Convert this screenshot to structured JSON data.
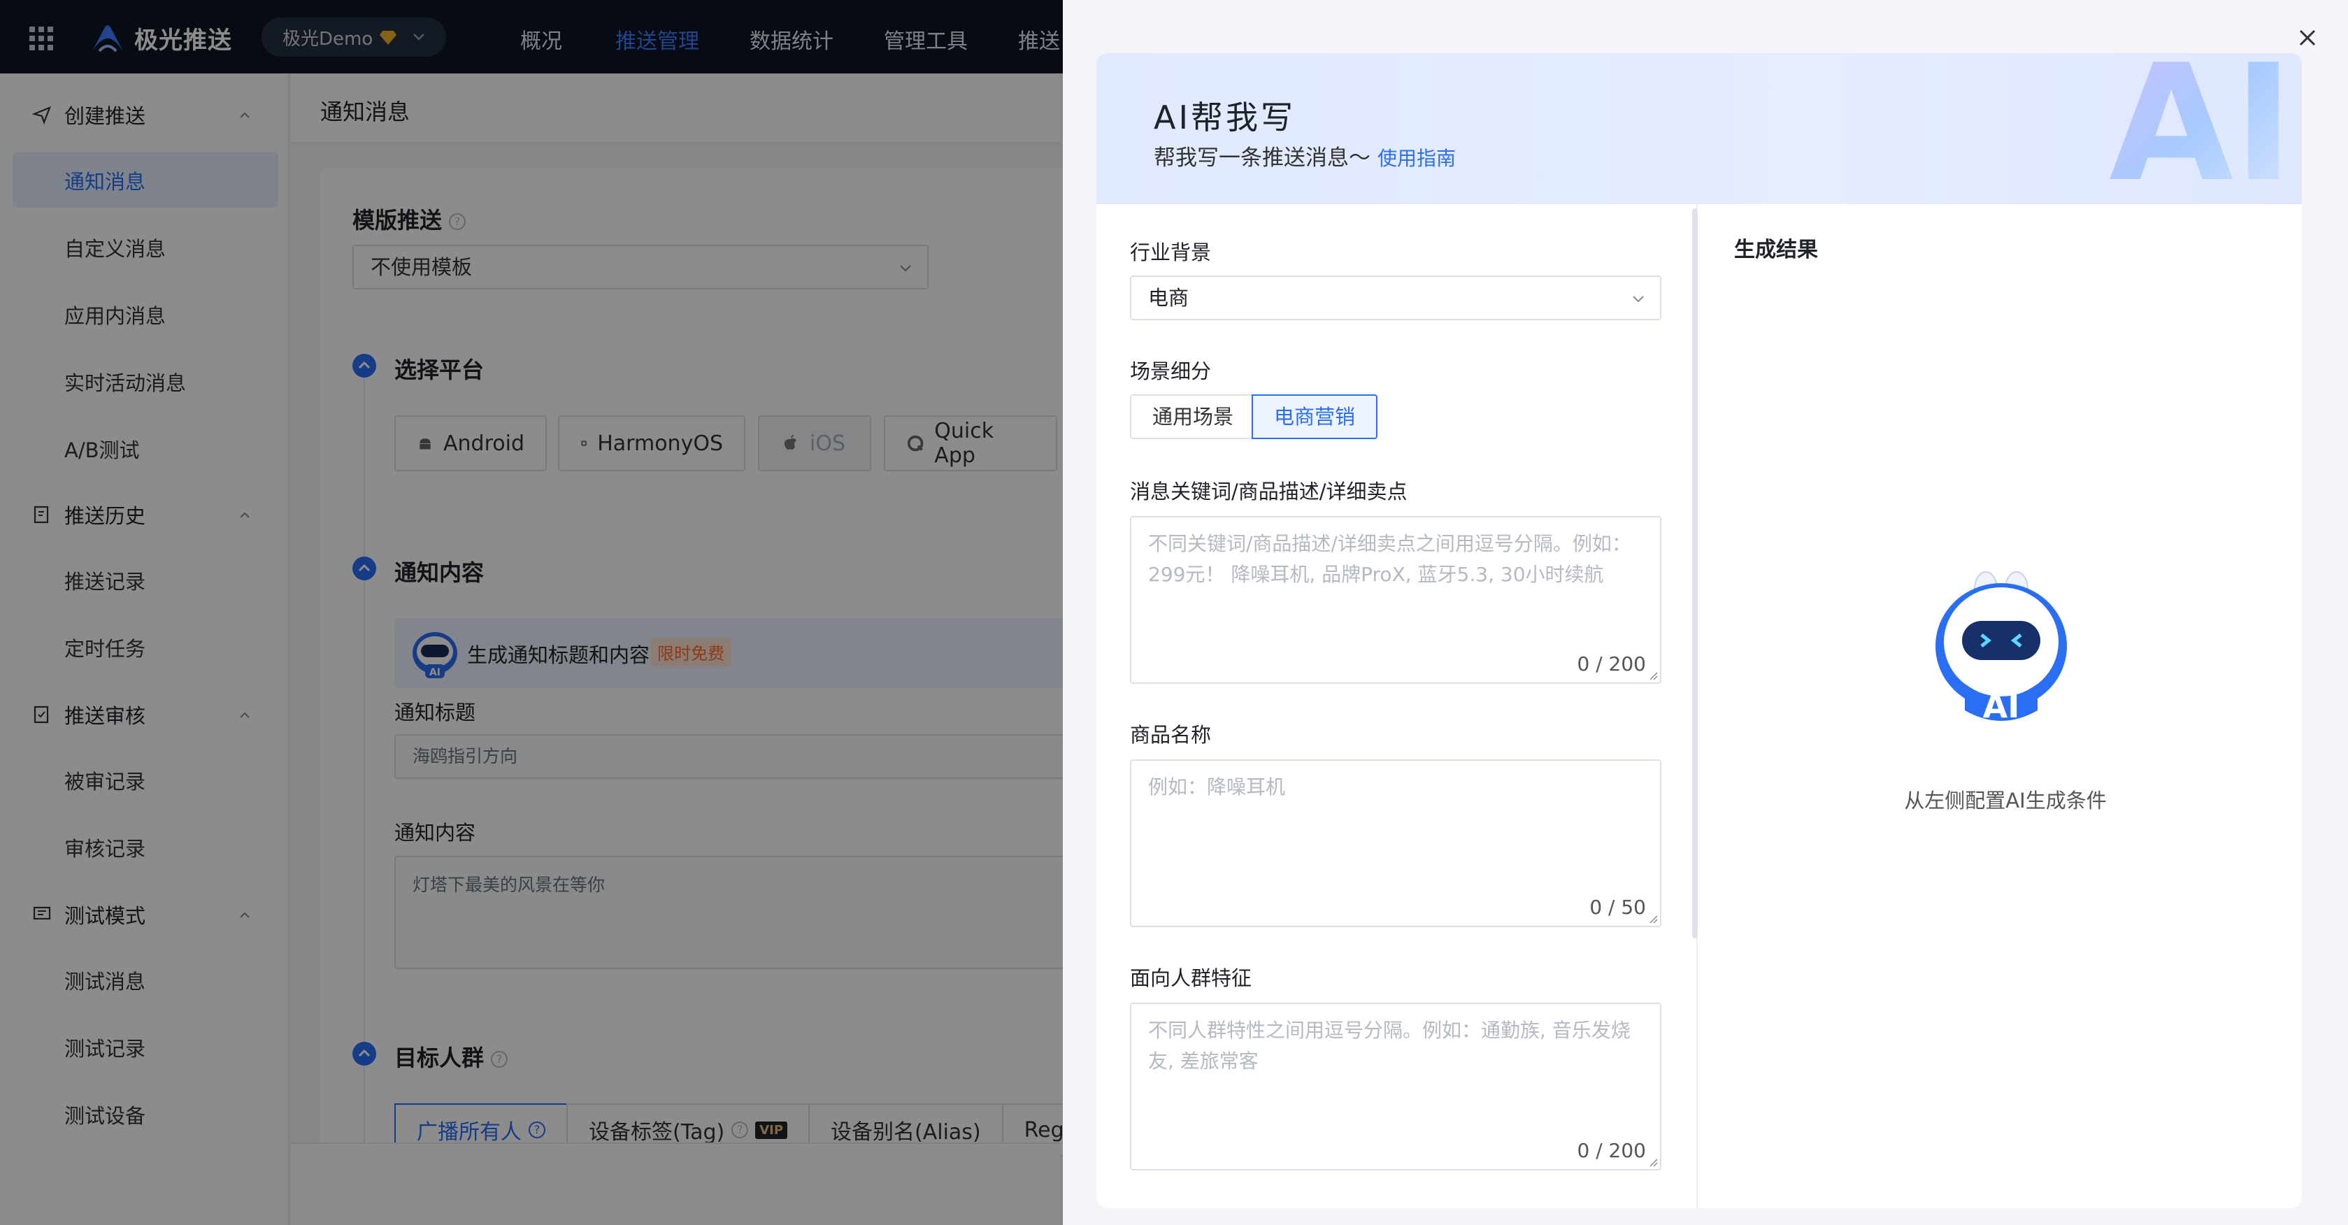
{
  "topbar": {
    "brand": "极光推送",
    "app_selector": "极光Demo",
    "nav": [
      "概况",
      "推送管理",
      "数据统计",
      "管理工具",
      "推送"
    ],
    "active_nav": "推送管理"
  },
  "sidebar": {
    "groups": [
      {
        "label": "创建推送",
        "items": [
          "通知消息",
          "自定义消息",
          "应用内消息",
          "实时活动消息",
          "A/B测试"
        ]
      },
      {
        "label": "推送历史",
        "items": [
          "推送记录",
          "定时任务"
        ]
      },
      {
        "label": "推送审核",
        "items": [
          "被审记录",
          "审核记录"
        ]
      },
      {
        "label": "测试模式",
        "items": [
          "测试消息",
          "测试记录",
          "测试设备"
        ]
      }
    ],
    "active_item": "通知消息"
  },
  "main": {
    "title": "通知消息",
    "template_label": "模版推送",
    "template_value": "不使用模板",
    "platform_label": "选择平台",
    "platforms": [
      "Android",
      "HarmonyOS",
      "iOS",
      "Quick App"
    ],
    "content_label": "通知内容",
    "ai_banner_text": "生成通知标题和内容",
    "ai_banner_badge": "限时免费",
    "title_field_label": "通知标题",
    "title_field_value": "海鸥指引方向",
    "content_field_label": "通知内容",
    "content_field_value": "灯塔下最美的风景在等你",
    "audience_label": "目标人群",
    "audience_tabs": [
      "广播所有人",
      "设备标签(Tag)",
      "设备别名(Alias)",
      "Registra"
    ],
    "vip_badge": "VIP"
  },
  "drawer": {
    "title": "AI帮我写",
    "subtitle": "帮我写一条推送消息～",
    "guide_link": "使用指南",
    "industry_label": "行业背景",
    "industry_value": "电商",
    "scene_label": "场景细分",
    "scenes": [
      "通用场景",
      "电商营销"
    ],
    "active_scene": "电商营销",
    "keywords_label": "消息关键词/商品描述/详细卖点",
    "keywords_placeholder": "不同关键词/商品描述/详细卖点之间用逗号分隔。例如：299元！ 降噪耳机, 品牌ProX, 蓝牙5.3, 30小时续航",
    "keywords_count": "0 / 200",
    "product_label": "商品名称",
    "product_placeholder": "例如：降噪耳机",
    "product_count": "0 / 50",
    "audience_label": "面向人群特征",
    "audience_placeholder": "不同人群特性之间用逗号分隔。例如：通勤族, 音乐发烧友, 差旅常客",
    "audience_count": "0 / 200",
    "result_label": "生成结果",
    "empty_text": "从左侧配置AI生成条件",
    "hero_art_text": "AI",
    "robot_text": "AI"
  },
  "colors": {
    "primary": "#2b6ef6",
    "topbar_bg": "#0e1726",
    "overlay": "rgba(0,0,0,0.45)",
    "free_badge": "#ff6a2b"
  }
}
